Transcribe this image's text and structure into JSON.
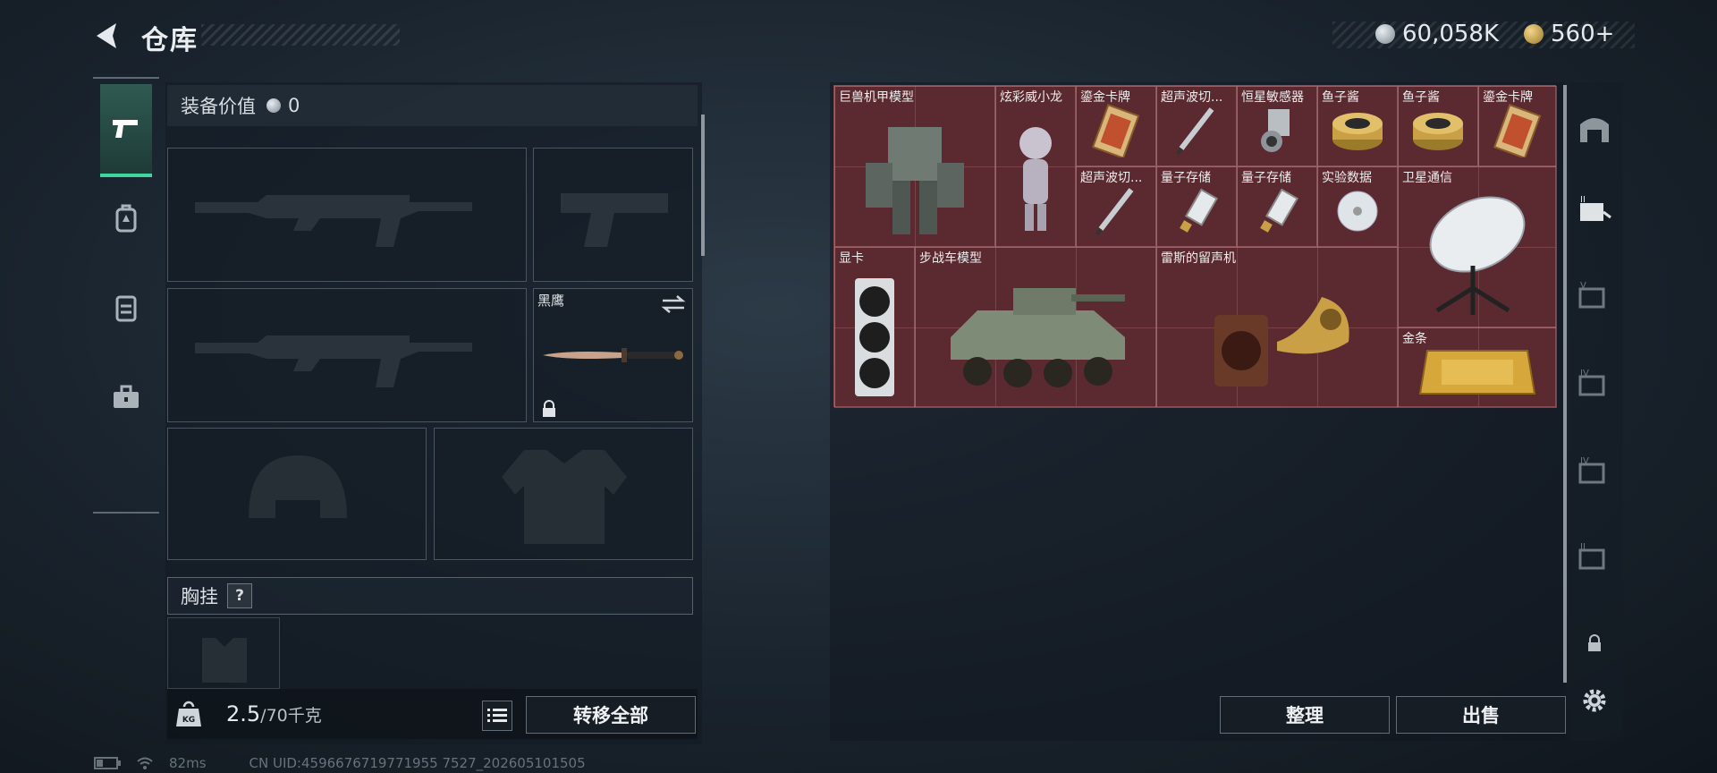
{
  "header": {
    "title": "仓库"
  },
  "currency": {
    "silver": "60,058K",
    "gold": "560+"
  },
  "loadout": {
    "value_label": "装备价值",
    "value": "0",
    "melee_name": "黑鹰",
    "chest_label": "胸挂",
    "help": "?",
    "weight_current": "2.5",
    "weight_max": "/70千克",
    "transfer_all": "转移全部"
  },
  "storage": {
    "items": [
      {
        "name": "巨兽机甲模型"
      },
      {
        "name": "炫彩威小龙"
      },
      {
        "name": "鎏金卡牌"
      },
      {
        "name": "超声波切..."
      },
      {
        "name": "恒星敏感器"
      },
      {
        "name": "鱼子酱"
      },
      {
        "name": "鱼子酱"
      },
      {
        "name": "鎏金卡牌"
      },
      {
        "name": "超声波切..."
      },
      {
        "name": "量子存储"
      },
      {
        "name": "量子存储"
      },
      {
        "name": "实验数据"
      },
      {
        "name": "卫星通信"
      },
      {
        "name": "显卡"
      },
      {
        "name": "步战车模型"
      },
      {
        "name": "雷斯的留声机"
      },
      {
        "name": "金条"
      }
    ],
    "tidy": "整理",
    "sell": "出售"
  },
  "status_bar": {
    "ping": "82ms",
    "uid": "CN UID:4596676719771955 7527_202605101505"
  },
  "colors": {
    "accent": "#3fd79e",
    "grid_bg": "#5a2a30"
  }
}
